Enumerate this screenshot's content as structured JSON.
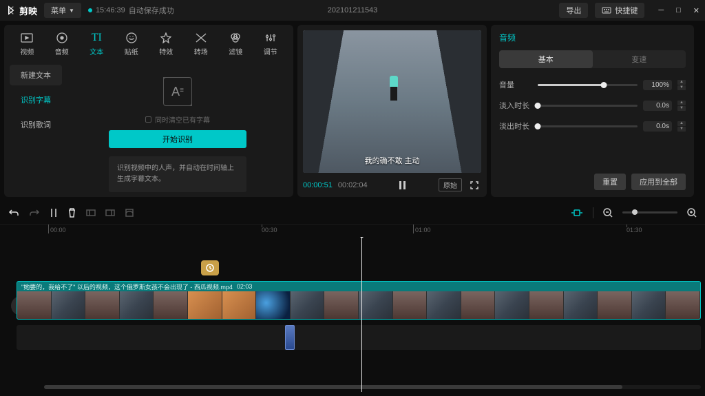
{
  "app": {
    "name": "剪映",
    "menu": "菜单",
    "autosave_time": "15:46:39",
    "autosave_msg": "自动保存成功",
    "project": "202101211543",
    "export": "导出",
    "hotkeys": "快捷键"
  },
  "tabs": {
    "video": "视频",
    "audio": "音频",
    "text": "文本",
    "sticker": "贴纸",
    "effect": "特效",
    "transition": "转场",
    "filter": "滤镜",
    "adjust": "调节"
  },
  "side": {
    "new_text": "新建文本",
    "recognize_sub": "识别字幕",
    "recognize_lyrics": "识别歌词"
  },
  "subtitle": {
    "clear_existing": "同时清空已有字幕",
    "start": "开始识别",
    "desc": "识别视频中的人声，并自动在时间轴上生成字幕文本。"
  },
  "preview": {
    "cur": "00:00:51",
    "total": "00:02:04",
    "original": "原始",
    "caption": "我的确不敢 主动"
  },
  "props": {
    "title": "音频",
    "tab_basic": "基本",
    "tab_speed": "变速",
    "volume": "音量",
    "volume_val": "100%",
    "fade_in": "淡入时长",
    "fade_in_val": "0.0s",
    "fade_out": "淡出时长",
    "fade_out_val": "0.0s",
    "reset": "重置",
    "apply_all": "应用到全部"
  },
  "timeline": {
    "ticks": [
      "00:00",
      "00:30",
      "01:00",
      "01:30"
    ],
    "clip_name": "\"她要的，我给不了\" 以后的视频，这个俄罗斯女孩不会出现了 - 西瓜视频.mp4",
    "clip_dur": "02:03"
  }
}
